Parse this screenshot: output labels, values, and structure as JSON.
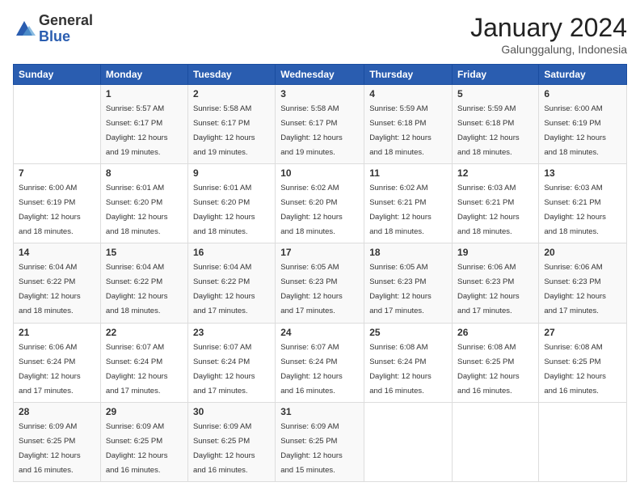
{
  "logo": {
    "general": "General",
    "blue": "Blue"
  },
  "title": "January 2024",
  "subtitle": "Galunggalung, Indonesia",
  "days_of_week": [
    "Sunday",
    "Monday",
    "Tuesday",
    "Wednesday",
    "Thursday",
    "Friday",
    "Saturday"
  ],
  "weeks": [
    [
      {
        "day": "",
        "info": ""
      },
      {
        "day": "1",
        "info": "Sunrise: 5:57 AM\nSunset: 6:17 PM\nDaylight: 12 hours\nand 19 minutes."
      },
      {
        "day": "2",
        "info": "Sunrise: 5:58 AM\nSunset: 6:17 PM\nDaylight: 12 hours\nand 19 minutes."
      },
      {
        "day": "3",
        "info": "Sunrise: 5:58 AM\nSunset: 6:17 PM\nDaylight: 12 hours\nand 19 minutes."
      },
      {
        "day": "4",
        "info": "Sunrise: 5:59 AM\nSunset: 6:18 PM\nDaylight: 12 hours\nand 18 minutes."
      },
      {
        "day": "5",
        "info": "Sunrise: 5:59 AM\nSunset: 6:18 PM\nDaylight: 12 hours\nand 18 minutes."
      },
      {
        "day": "6",
        "info": "Sunrise: 6:00 AM\nSunset: 6:19 PM\nDaylight: 12 hours\nand 18 minutes."
      }
    ],
    [
      {
        "day": "7",
        "info": "Sunrise: 6:00 AM\nSunset: 6:19 PM\nDaylight: 12 hours\nand 18 minutes."
      },
      {
        "day": "8",
        "info": "Sunrise: 6:01 AM\nSunset: 6:20 PM\nDaylight: 12 hours\nand 18 minutes."
      },
      {
        "day": "9",
        "info": "Sunrise: 6:01 AM\nSunset: 6:20 PM\nDaylight: 12 hours\nand 18 minutes."
      },
      {
        "day": "10",
        "info": "Sunrise: 6:02 AM\nSunset: 6:20 PM\nDaylight: 12 hours\nand 18 minutes."
      },
      {
        "day": "11",
        "info": "Sunrise: 6:02 AM\nSunset: 6:21 PM\nDaylight: 12 hours\nand 18 minutes."
      },
      {
        "day": "12",
        "info": "Sunrise: 6:03 AM\nSunset: 6:21 PM\nDaylight: 12 hours\nand 18 minutes."
      },
      {
        "day": "13",
        "info": "Sunrise: 6:03 AM\nSunset: 6:21 PM\nDaylight: 12 hours\nand 18 minutes."
      }
    ],
    [
      {
        "day": "14",
        "info": "Sunrise: 6:04 AM\nSunset: 6:22 PM\nDaylight: 12 hours\nand 18 minutes."
      },
      {
        "day": "15",
        "info": "Sunrise: 6:04 AM\nSunset: 6:22 PM\nDaylight: 12 hours\nand 18 minutes."
      },
      {
        "day": "16",
        "info": "Sunrise: 6:04 AM\nSunset: 6:22 PM\nDaylight: 12 hours\nand 17 minutes."
      },
      {
        "day": "17",
        "info": "Sunrise: 6:05 AM\nSunset: 6:23 PM\nDaylight: 12 hours\nand 17 minutes."
      },
      {
        "day": "18",
        "info": "Sunrise: 6:05 AM\nSunset: 6:23 PM\nDaylight: 12 hours\nand 17 minutes."
      },
      {
        "day": "19",
        "info": "Sunrise: 6:06 AM\nSunset: 6:23 PM\nDaylight: 12 hours\nand 17 minutes."
      },
      {
        "day": "20",
        "info": "Sunrise: 6:06 AM\nSunset: 6:23 PM\nDaylight: 12 hours\nand 17 minutes."
      }
    ],
    [
      {
        "day": "21",
        "info": "Sunrise: 6:06 AM\nSunset: 6:24 PM\nDaylight: 12 hours\nand 17 minutes."
      },
      {
        "day": "22",
        "info": "Sunrise: 6:07 AM\nSunset: 6:24 PM\nDaylight: 12 hours\nand 17 minutes."
      },
      {
        "day": "23",
        "info": "Sunrise: 6:07 AM\nSunset: 6:24 PM\nDaylight: 12 hours\nand 17 minutes."
      },
      {
        "day": "24",
        "info": "Sunrise: 6:07 AM\nSunset: 6:24 PM\nDaylight: 12 hours\nand 16 minutes."
      },
      {
        "day": "25",
        "info": "Sunrise: 6:08 AM\nSunset: 6:24 PM\nDaylight: 12 hours\nand 16 minutes."
      },
      {
        "day": "26",
        "info": "Sunrise: 6:08 AM\nSunset: 6:25 PM\nDaylight: 12 hours\nand 16 minutes."
      },
      {
        "day": "27",
        "info": "Sunrise: 6:08 AM\nSunset: 6:25 PM\nDaylight: 12 hours\nand 16 minutes."
      }
    ],
    [
      {
        "day": "28",
        "info": "Sunrise: 6:09 AM\nSunset: 6:25 PM\nDaylight: 12 hours\nand 16 minutes."
      },
      {
        "day": "29",
        "info": "Sunrise: 6:09 AM\nSunset: 6:25 PM\nDaylight: 12 hours\nand 16 minutes."
      },
      {
        "day": "30",
        "info": "Sunrise: 6:09 AM\nSunset: 6:25 PM\nDaylight: 12 hours\nand 16 minutes."
      },
      {
        "day": "31",
        "info": "Sunrise: 6:09 AM\nSunset: 6:25 PM\nDaylight: 12 hours\nand 15 minutes."
      },
      {
        "day": "",
        "info": ""
      },
      {
        "day": "",
        "info": ""
      },
      {
        "day": "",
        "info": ""
      }
    ]
  ]
}
